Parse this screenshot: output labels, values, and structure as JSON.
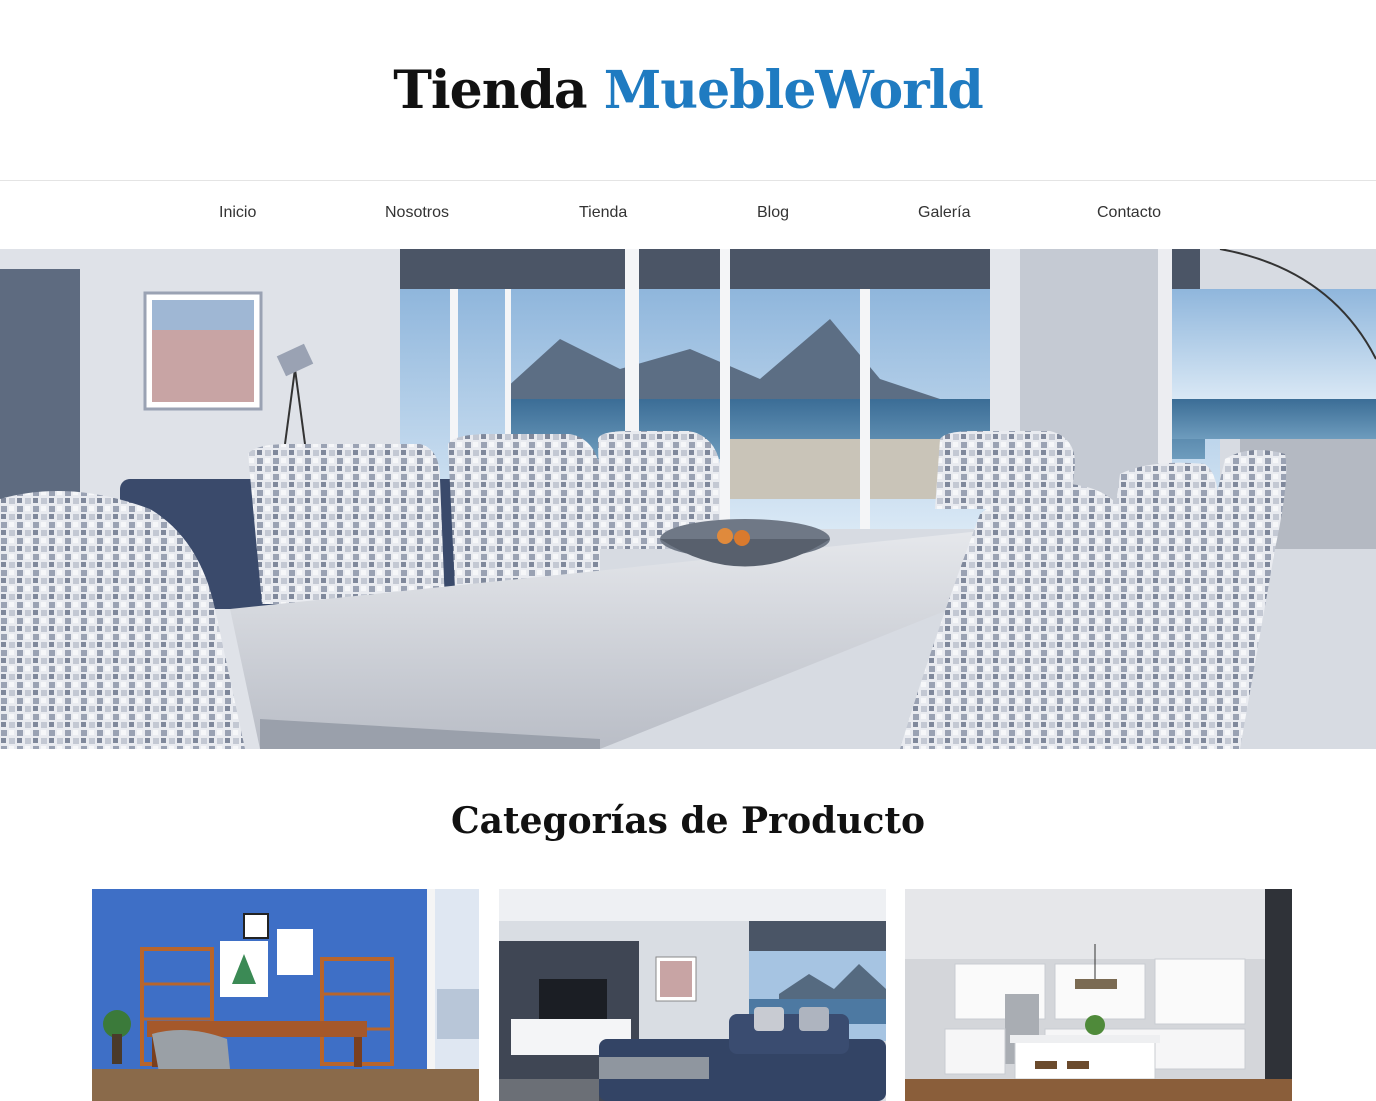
{
  "header": {
    "title_part1": "Tienda",
    "title_part2": "MuebleWorld"
  },
  "nav": {
    "items": [
      {
        "label": "Inicio"
      },
      {
        "label": "Nosotros"
      },
      {
        "label": "Tienda"
      },
      {
        "label": "Blog"
      },
      {
        "label": "Galería"
      },
      {
        "label": "Contacto"
      }
    ]
  },
  "main": {
    "section_title": "Categorías de Producto"
  },
  "colors": {
    "accent": "#1f7bc1",
    "title": "#111111",
    "nav_text": "#333333",
    "divider": "#e4e4e4"
  }
}
